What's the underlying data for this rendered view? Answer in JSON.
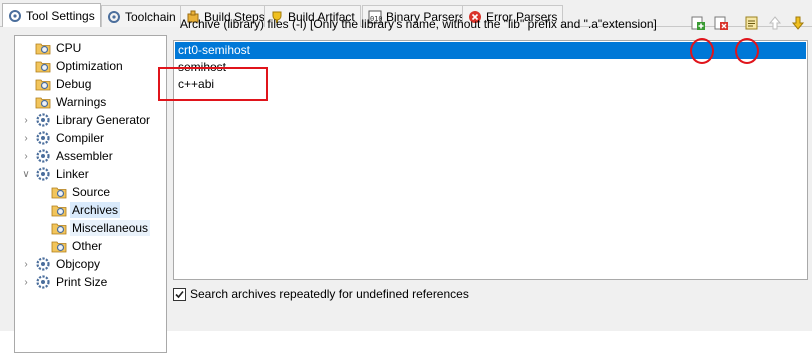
{
  "tabs": [
    {
      "label": "Tool Settings",
      "icon": "tool-settings-icon",
      "active": true
    },
    {
      "label": "Toolchain",
      "icon": "toolchain-icon",
      "active": false
    },
    {
      "label": "Build Steps",
      "icon": "build-steps-icon",
      "active": false
    },
    {
      "label": "Build Artifact",
      "icon": "build-artifact-icon",
      "active": false
    },
    {
      "label": "Binary Parsers",
      "icon": "binary-parsers-icon",
      "active": false
    },
    {
      "label": "Error Parsers",
      "icon": "error-parsers-icon",
      "active": false
    }
  ],
  "tree": [
    {
      "label": "CPU",
      "icon": "folder-settings-icon",
      "expandable": false,
      "selected": false
    },
    {
      "label": "Optimization",
      "icon": "folder-settings-icon",
      "expandable": false,
      "selected": false
    },
    {
      "label": "Debug",
      "icon": "folder-settings-icon",
      "expandable": false,
      "selected": false
    },
    {
      "label": "Warnings",
      "icon": "folder-settings-icon",
      "expandable": false,
      "selected": false
    },
    {
      "label": "Library Generator",
      "icon": "gear-icon",
      "expandable": true,
      "expanded": false,
      "selected": false
    },
    {
      "label": "Compiler",
      "icon": "gear-icon",
      "expandable": true,
      "expanded": false,
      "selected": false
    },
    {
      "label": "Assembler",
      "icon": "gear-icon",
      "expandable": true,
      "expanded": false,
      "selected": false
    },
    {
      "label": "Linker",
      "icon": "gear-icon",
      "expandable": true,
      "expanded": true,
      "selected": false
    },
    {
      "label": "Source",
      "icon": "folder-settings-icon",
      "expandable": false,
      "selected": false,
      "child": true
    },
    {
      "label": "Archives",
      "icon": "folder-settings-icon",
      "expandable": false,
      "selected": true,
      "child": true
    },
    {
      "label": "Miscellaneous",
      "icon": "folder-settings-icon",
      "expandable": false,
      "selected": false,
      "child": true,
      "hover": true
    },
    {
      "label": "Other",
      "icon": "folder-settings-icon",
      "expandable": false,
      "selected": false,
      "child": true
    },
    {
      "label": "Objcopy",
      "icon": "gear-icon",
      "expandable": true,
      "expanded": false,
      "selected": false
    },
    {
      "label": "Print Size",
      "icon": "gear-icon",
      "expandable": true,
      "expanded": false,
      "selected": false
    }
  ],
  "archives": {
    "header": "Archive (library) files (-l) [Only the library's name, without the \"lib\" prefix and \".a\"extension]",
    "toolbar": [
      "add-icon",
      "delete-icon",
      "edit-icon",
      "move-up-icon",
      "move-down-icon"
    ],
    "items": [
      {
        "label": "crt0-semihost",
        "selected": true
      },
      {
        "label": "semihost",
        "selected": false
      },
      {
        "label": "c++abi",
        "selected": false
      }
    ]
  },
  "search_repeatedly": {
    "label": "Search archives repeatedly for undefined references",
    "checked": true
  },
  "colors": {
    "selection": "#0078d7",
    "annotation": "#e0141b"
  }
}
